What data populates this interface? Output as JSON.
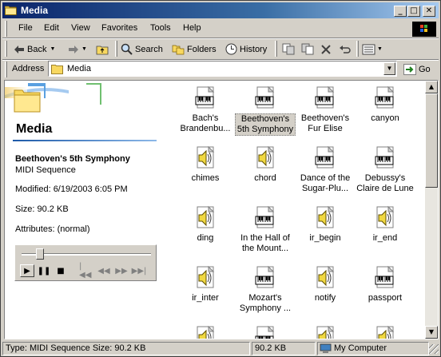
{
  "window": {
    "title": "Media"
  },
  "menu": [
    "File",
    "Edit",
    "View",
    "Favorites",
    "Tools",
    "Help"
  ],
  "toolbar": {
    "back": "Back",
    "search": "Search",
    "folders": "Folders",
    "history": "History"
  },
  "address": {
    "label": "Address",
    "value": "Media",
    "go": "Go"
  },
  "left_pane": {
    "title": "Media",
    "file_name": "Beethoven's 5th Symphony",
    "file_type": "MIDI Sequence",
    "modified": "Modified: 6/19/2003 6:05 PM",
    "size": "Size: 90.2 KB",
    "attributes": "Attributes: (normal)"
  },
  "player": {
    "position": 0.12
  },
  "files": [
    {
      "label": "Bach's Brandenbu...",
      "type": "midi"
    },
    {
      "label": "Beethoven's 5th Symphony",
      "type": "midi",
      "selected": true
    },
    {
      "label": "Beethoven's Fur Elise",
      "type": "midi"
    },
    {
      "label": "canyon",
      "type": "midi"
    },
    {
      "label": "chimes",
      "type": "wav"
    },
    {
      "label": "chord",
      "type": "wav"
    },
    {
      "label": "Dance of the Sugar-Plu...",
      "type": "midi"
    },
    {
      "label": "Debussy's Claire de Lune",
      "type": "midi"
    },
    {
      "label": "ding",
      "type": "wav"
    },
    {
      "label": "In the Hall of the Mount...",
      "type": "midi"
    },
    {
      "label": "ir_begin",
      "type": "wav"
    },
    {
      "label": "ir_end",
      "type": "wav"
    },
    {
      "label": "ir_inter",
      "type": "wav"
    },
    {
      "label": "Mozart's Symphony ...",
      "type": "midi"
    },
    {
      "label": "notify",
      "type": "wav"
    },
    {
      "label": "passport",
      "type": "midi"
    },
    {
      "label": "",
      "type": "wav"
    },
    {
      "label": "",
      "type": "midi"
    },
    {
      "label": "",
      "type": "wav"
    },
    {
      "label": "",
      "type": "wav"
    }
  ],
  "status": {
    "description": "Type: MIDI Sequence Size: 90.2 KB",
    "size": "90.2 KB",
    "zone": "My Computer"
  },
  "colors": {
    "title_start": "#0a246a",
    "title_end": "#a6caf0",
    "face": "#d4d0c8"
  }
}
